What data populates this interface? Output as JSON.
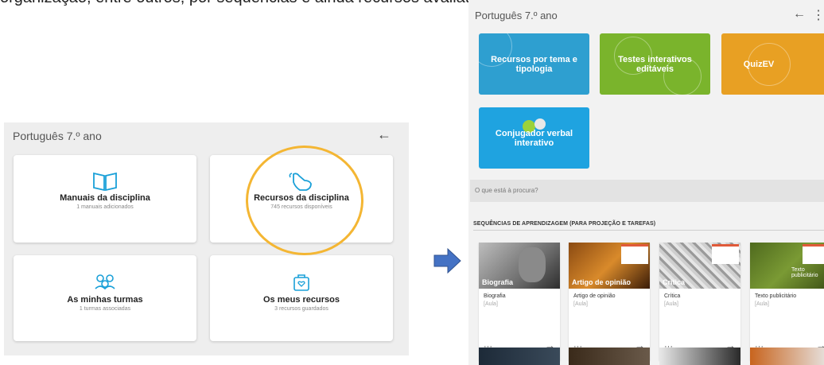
{
  "caption": "organização, entre outros, por sequências e ainda recursos avaliativos.",
  "left_panel": {
    "title": "Português 7.º ano",
    "cards": [
      {
        "title": "Manuais da disciplina",
        "subtitle": "1 manuais adicionados",
        "icon": "book-icon"
      },
      {
        "title": "Recursos da disciplina",
        "subtitle": "745 recursos disponíveis",
        "icon": "pointing-hand-icon"
      },
      {
        "title": "As minhas turmas",
        "subtitle": "1 turmas associadas",
        "icon": "group-icon"
      },
      {
        "title": "Os meus recursos",
        "subtitle": "3 recursos guardados",
        "icon": "saved-resources-icon"
      }
    ],
    "highlight_color": "#f4b633"
  },
  "arrow_color": "#4472c4",
  "right_panel": {
    "title": "Português 7.º ano",
    "tiles": [
      {
        "label": "Recursos por tema e tipologia",
        "color": "#2e9fd0"
      },
      {
        "label": "Testes interativos editáveis",
        "color": "#7ab42c"
      },
      {
        "label": "QuizEV",
        "color": "#e8a023"
      },
      {
        "label": "Conjugador verbal interativo",
        "color": "#1fa3e0"
      }
    ],
    "search_placeholder": "O que está à procura?",
    "section_title": "SEQUÊNCIAS DE APRENDIZAGEM (PARA PROJEÇÃO E TAREFAS)",
    "lessons": [
      {
        "overlay": "Biografia",
        "name": "Biografia",
        "type": "[Aula]"
      },
      {
        "overlay": "Artigo de opinião",
        "name": "Artigo de opinião",
        "type": "[Aula]"
      },
      {
        "overlay": "Crítica",
        "name": "Crítica",
        "type": "[Aula]"
      },
      {
        "overlay": "Texto publicitário",
        "name": "Texto publicitário",
        "type": "[Aula]"
      }
    ],
    "more_symbol": "···",
    "go_symbol": "→",
    "back_symbol": "←",
    "menu_symbol": "⋮"
  }
}
